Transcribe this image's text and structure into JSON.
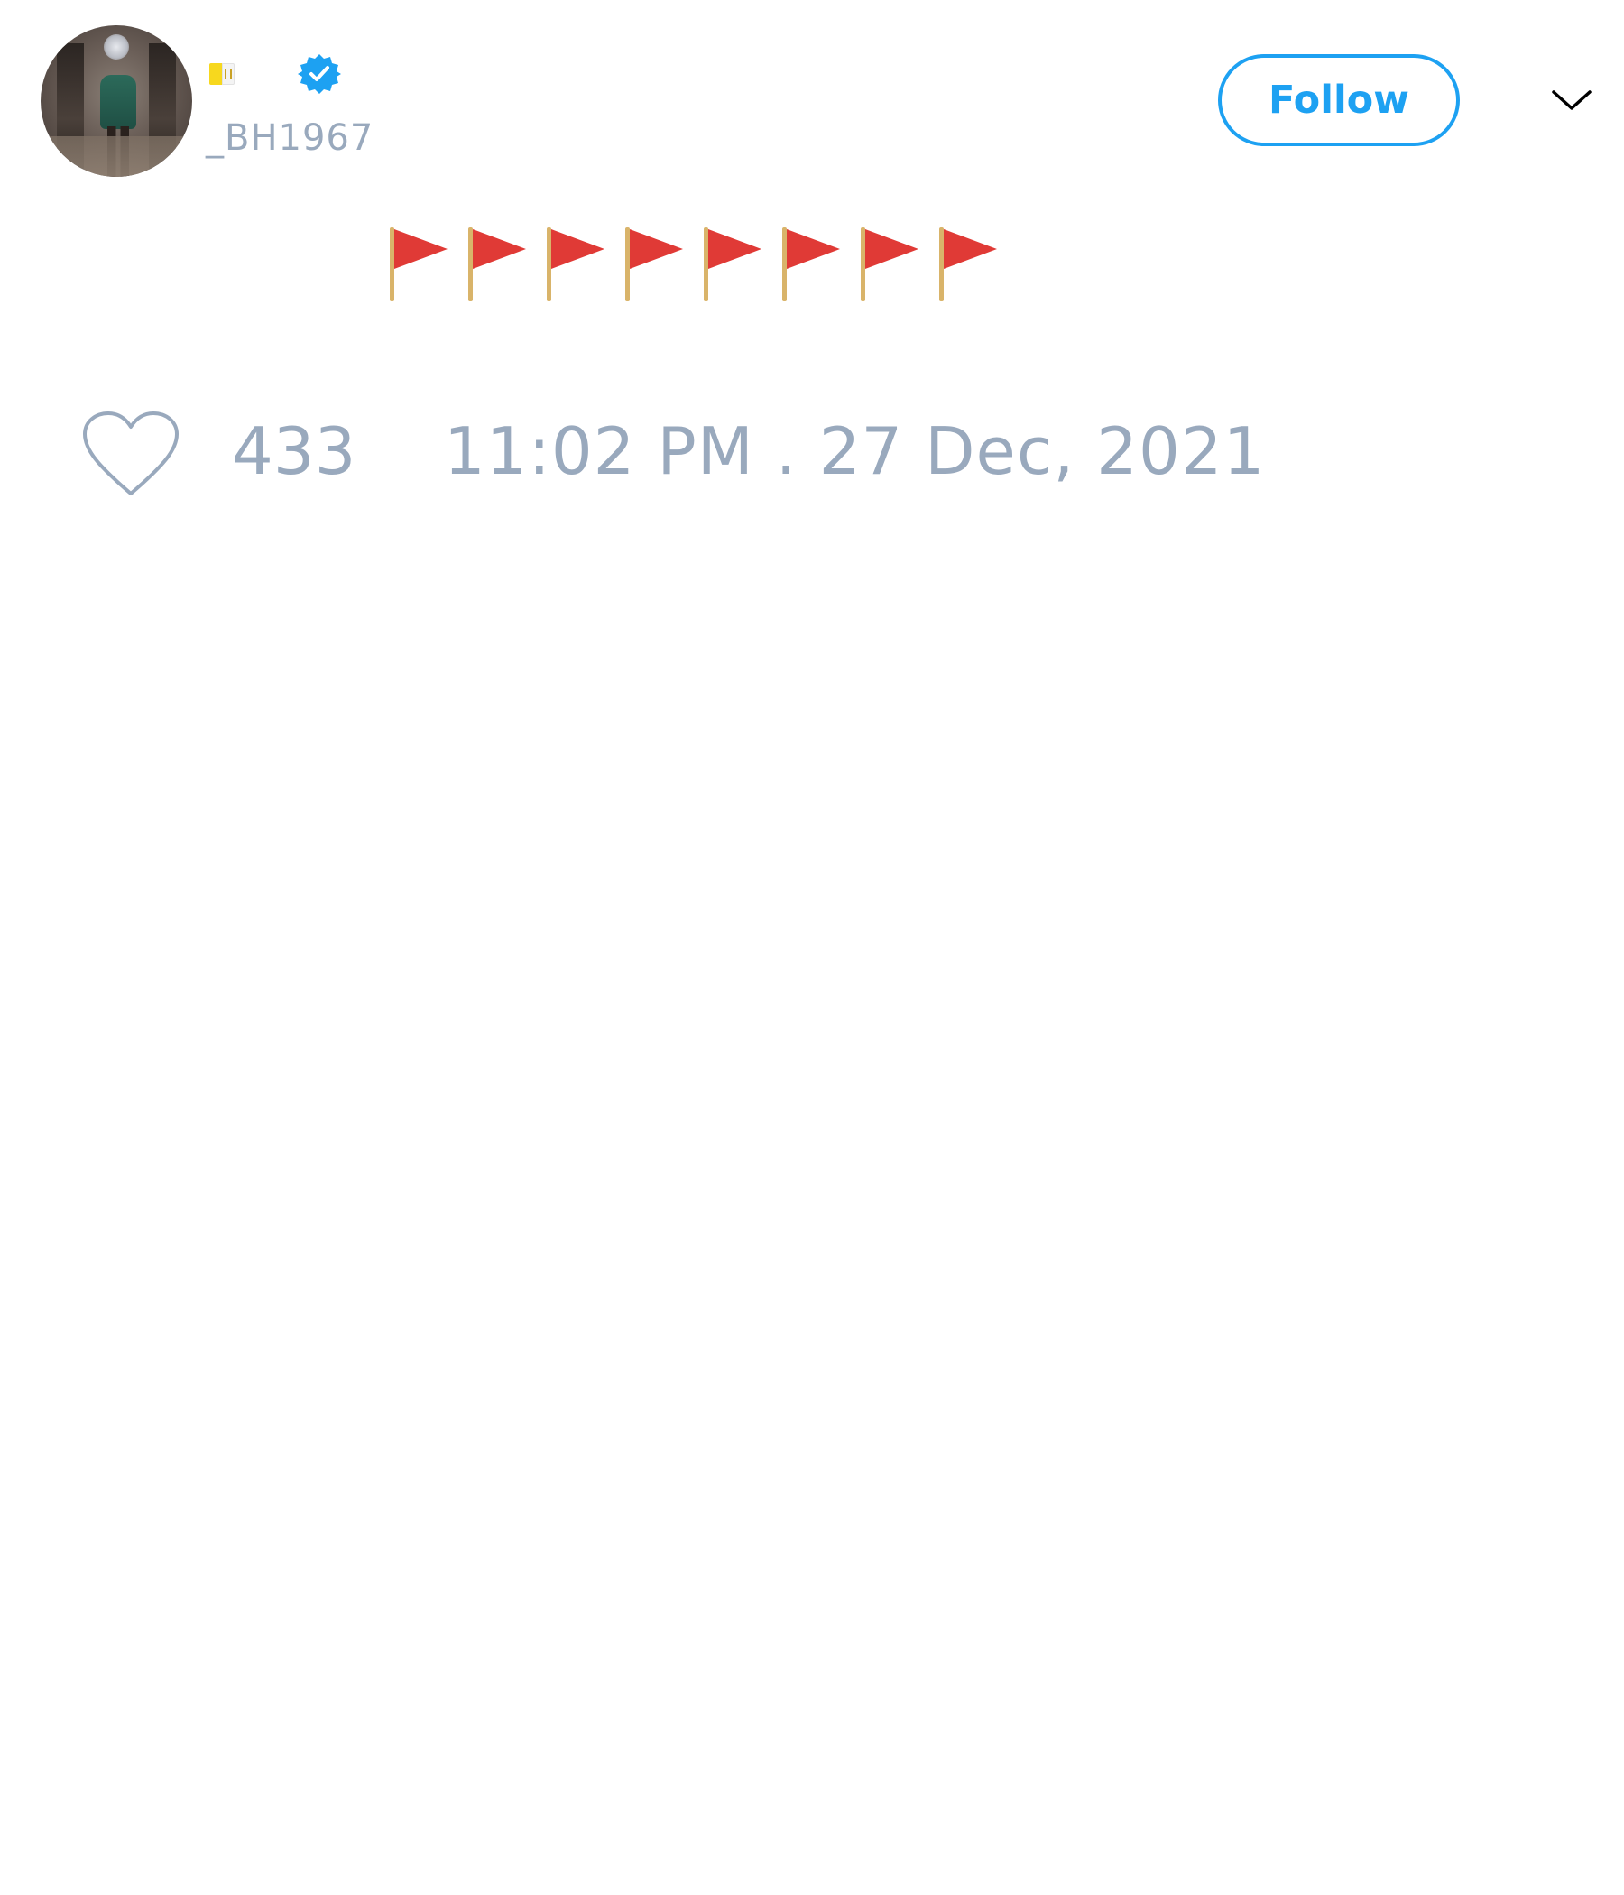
{
  "user": {
    "display_name_emoji": "vatican-flag",
    "handle": "_BH1967",
    "verified": true
  },
  "follow_button": {
    "label": "Follow"
  },
  "menu": {
    "icon": "chevron-down-icon"
  },
  "tweet": {
    "text": "🚩🚩🚩🚩🚩🚩🚩🚩",
    "flag_count": 8
  },
  "stats": {
    "likes": "433",
    "timestamp": "11:02 PM . 27 Dec, 2021"
  },
  "colors": {
    "accent": "#1da1f2",
    "muted_text": "#99a9bd",
    "flag_red": "#e03a36",
    "pole": "#d9b46a"
  }
}
